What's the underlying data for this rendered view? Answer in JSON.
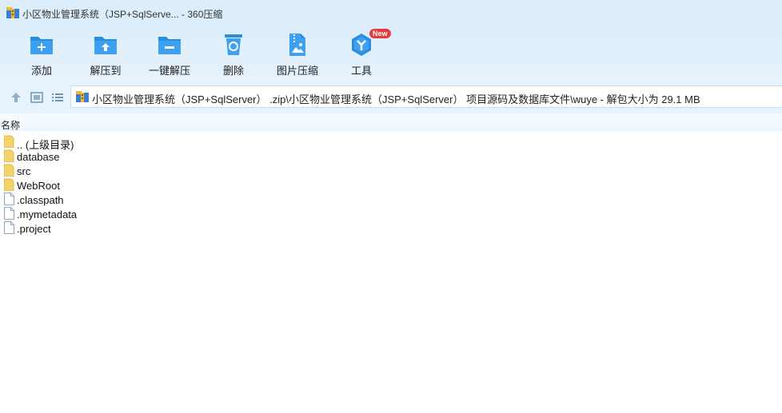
{
  "window": {
    "title": "小区物业管理系统（JSP+SqlServe... - 360压缩"
  },
  "toolbar": {
    "items": [
      {
        "label": "添加",
        "icon": "add-folder-icon"
      },
      {
        "label": "解压到",
        "icon": "extract-to-icon"
      },
      {
        "label": "一键解压",
        "icon": "one-click-extract-icon"
      },
      {
        "label": "删除",
        "icon": "recycle-bin-icon"
      },
      {
        "label": "图片压缩",
        "icon": "image-compress-icon"
      },
      {
        "label": "工具",
        "icon": "tools-icon",
        "badge": "New"
      }
    ]
  },
  "address": {
    "path": "小区物业管理系统（JSP+SqlServer） .zip\\小区物业管理系统（JSP+SqlServer） 项目源码及数据库文件\\wuye - 解包大小为 29.1 MB"
  },
  "list": {
    "column_name": "名称",
    "items": [
      {
        "name": ".. (上级目录)",
        "type": "folder"
      },
      {
        "name": "database",
        "type": "folder"
      },
      {
        "name": "src",
        "type": "folder"
      },
      {
        "name": "WebRoot",
        "type": "folder"
      },
      {
        "name": ".classpath",
        "type": "file"
      },
      {
        "name": ".mymetadata",
        "type": "file"
      },
      {
        "name": ".project",
        "type": "file"
      }
    ]
  },
  "colors": {
    "toolbar_bg": "#dceefb",
    "icon_blue": "#2b8de0",
    "folder_yellow": "#f5d36b",
    "badge_red": "#e63b3b"
  }
}
